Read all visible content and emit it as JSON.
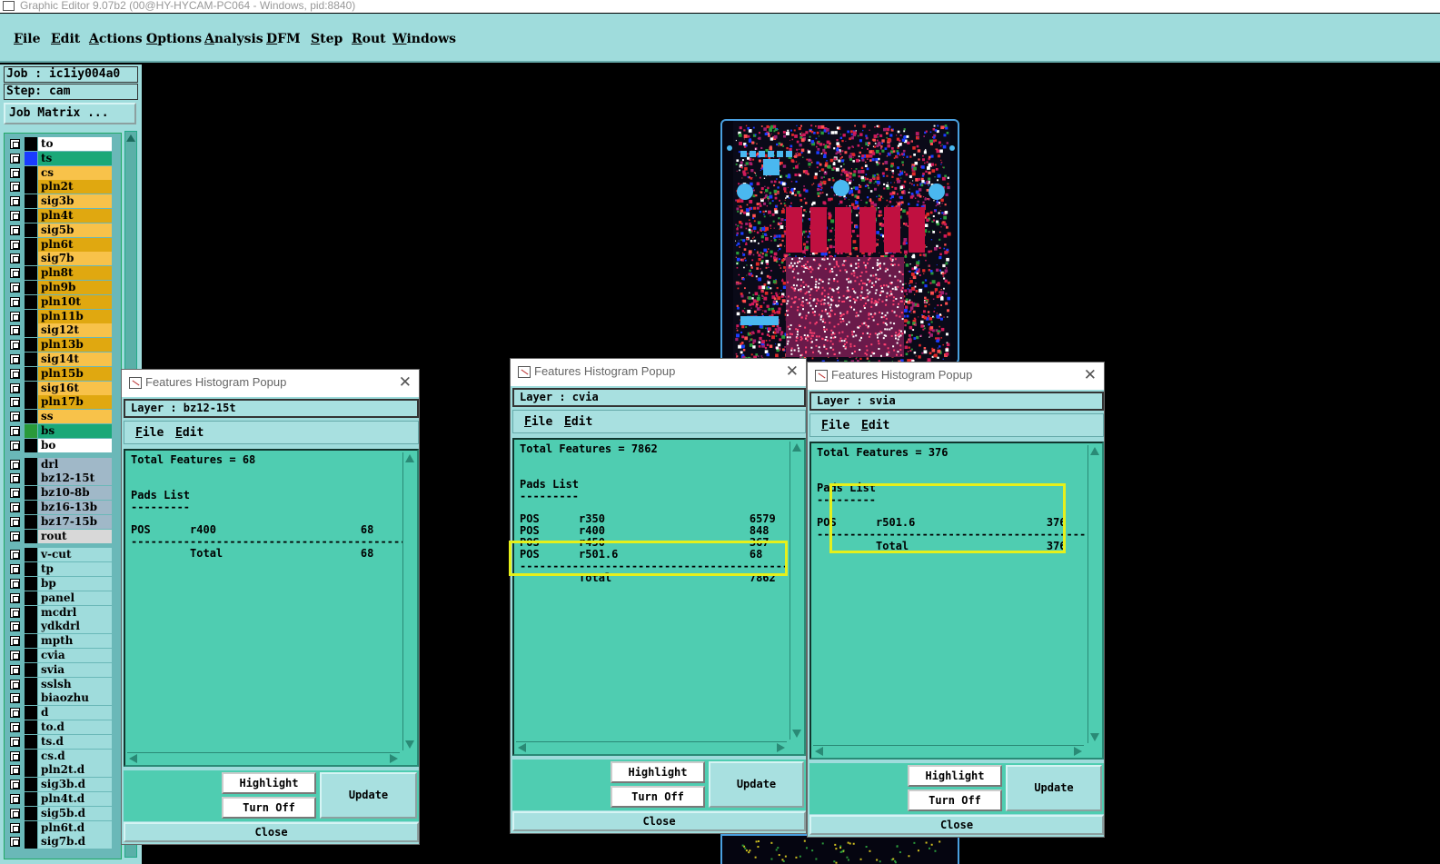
{
  "window": {
    "title": "Graphic Editor 9.07b2 (00@HY-HYCAM-PC064 - Windows, pid:8840)"
  },
  "menu": [
    "File",
    "Edit",
    "Actions",
    "Options",
    "Analysis",
    "DFM",
    "Step",
    "Rout",
    "Windows"
  ],
  "job": {
    "job_label": "Job : ic1iy004a0",
    "step_label": "Step: cam",
    "matrix_button": "Job Matrix ..."
  },
  "layers": [
    {
      "name": "to",
      "color": "#ffffff",
      "swatch": "#000000",
      "edit": "&#9998;"
    },
    {
      "name": "ts",
      "color": "#1aa878",
      "swatch": "#1a3cff"
    },
    {
      "name": "cs",
      "color": "#f8c24a",
      "swatch": "#000000"
    },
    {
      "name": "pln2t",
      "color": "#e0a810",
      "swatch": "#000000"
    },
    {
      "name": "sig3b",
      "color": "#f8c24a",
      "swatch": "#000000"
    },
    {
      "name": "pln4t",
      "color": "#e0a810",
      "swatch": "#000000"
    },
    {
      "name": "sig5b",
      "color": "#f8c24a",
      "swatch": "#000000"
    },
    {
      "name": "pln6t",
      "color": "#e0a810",
      "swatch": "#000000"
    },
    {
      "name": "sig7b",
      "color": "#f8c24a",
      "swatch": "#000000"
    },
    {
      "name": "pln8t",
      "color": "#e0a810",
      "swatch": "#000000"
    },
    {
      "name": "pln9b",
      "color": "#e0a810",
      "swatch": "#000000"
    },
    {
      "name": "pln10t",
      "color": "#e0a810",
      "swatch": "#000000"
    },
    {
      "name": "pln11b",
      "color": "#e0a810",
      "swatch": "#000000"
    },
    {
      "name": "sig12t",
      "color": "#f8c24a",
      "swatch": "#000000"
    },
    {
      "name": "pln13b",
      "color": "#e0a810",
      "swatch": "#000000"
    },
    {
      "name": "sig14t",
      "color": "#f8c24a",
      "swatch": "#000000"
    },
    {
      "name": "pln15b",
      "color": "#e0a810",
      "swatch": "#000000"
    },
    {
      "name": "sig16t",
      "color": "#f8c24a",
      "swatch": "#000000"
    },
    {
      "name": "pln17b",
      "color": "#e0a810",
      "swatch": "#000000"
    },
    {
      "name": "ss",
      "color": "#f8c24a",
      "swatch": "#000000"
    },
    {
      "name": "bs",
      "color": "#1aa878",
      "swatch": "#2a9a3a"
    },
    {
      "name": "bo",
      "color": "#ffffff",
      "swatch": "#000000"
    },
    {
      "gap": true
    },
    {
      "name": "drl",
      "color": "#a0b8c8",
      "swatch": "#000000"
    },
    {
      "name": "bz12-15t",
      "color": "#a0b8c8",
      "swatch": "#000000"
    },
    {
      "name": "bz10-8b",
      "color": "#a0b8c8",
      "swatch": "#000000"
    },
    {
      "name": "bz16-13b",
      "color": "#a0b8c8",
      "swatch": "#000000"
    },
    {
      "name": "bz17-15b",
      "color": "#a0b8c8",
      "swatch": "#000000"
    },
    {
      "name": "rout",
      "color": "#d8d8d8",
      "swatch": "#000000"
    },
    {
      "gap": true
    },
    {
      "name": "v-cut",
      "color": "#9fdcdc",
      "swatch": "#000000"
    },
    {
      "name": "tp",
      "color": "#9fdcdc",
      "swatch": "#000000"
    },
    {
      "name": "bp",
      "color": "#9fdcdc",
      "swatch": "#000000"
    },
    {
      "name": "panel",
      "color": "#9fdcdc",
      "swatch": "#000000"
    },
    {
      "name": "mcdrl",
      "color": "#9fdcdc",
      "swatch": "#000000"
    },
    {
      "name": "ydkdrl",
      "color": "#9fdcdc",
      "swatch": "#000000"
    },
    {
      "name": "mpth",
      "color": "#9fdcdc",
      "swatch": "#000000"
    },
    {
      "name": "cvia",
      "color": "#9fdcdc",
      "swatch": "#000000"
    },
    {
      "name": "svia",
      "color": "#9fdcdc",
      "swatch": "#000000"
    },
    {
      "name": "sslsh",
      "color": "#9fdcdc",
      "swatch": "#000000"
    },
    {
      "name": "biaozhu",
      "color": "#9fdcdc",
      "swatch": "#000000"
    },
    {
      "name": "d",
      "color": "#9fdcdc",
      "swatch": "#000000"
    },
    {
      "name": "to.d",
      "color": "#9fdcdc",
      "swatch": "#000000"
    },
    {
      "name": "ts.d",
      "color": "#9fdcdc",
      "swatch": "#000000"
    },
    {
      "name": "cs.d",
      "color": "#9fdcdc",
      "swatch": "#000000"
    },
    {
      "name": "pln2t.d",
      "color": "#9fdcdc",
      "swatch": "#000000"
    },
    {
      "name": "sig3b.d",
      "color": "#9fdcdc",
      "swatch": "#000000"
    },
    {
      "name": "pln4t.d",
      "color": "#9fdcdc",
      "swatch": "#000000"
    },
    {
      "name": "sig5b.d",
      "color": "#9fdcdc",
      "swatch": "#000000"
    },
    {
      "name": "pln6t.d",
      "color": "#9fdcdc",
      "swatch": "#000000"
    },
    {
      "name": "sig7b.d",
      "color": "#9fdcdc",
      "swatch": "#000000"
    }
  ],
  "popups": [
    {
      "title": "Features Histogram Popup",
      "layer": "Layer :  bz12-15t",
      "menu": [
        "File",
        "Edit"
      ],
      "text": "Total Features = 68\n\n\nPads List\n---------\n\nPOS      r400                      68\n------------------------------------------\n         Total                     68",
      "buttons": {
        "highlight": "Highlight",
        "turn_off": "Turn Off",
        "update": "Update",
        "close": "Close"
      }
    },
    {
      "title": "Features Histogram Popup",
      "layer": "Layer :  cvia",
      "menu": [
        "File",
        "Edit"
      ],
      "text": "Total Features = 7862\n\n\nPads List\n---------\n\nPOS      r350                      6579\nPOS      r400                      848\nPOS      r450                      367\nPOS      r501.6                    68\n------------------------------------------\n         Total                     7862",
      "buttons": {
        "highlight": "Highlight",
        "turn_off": "Turn Off",
        "update": "Update",
        "close": "Close"
      }
    },
    {
      "title": "Features Histogram Popup",
      "layer": "Layer :  svia",
      "menu": [
        "File",
        "Edit"
      ],
      "text": "Total Features = 376\n\n\nPads List\n---------\n\nPOS      r501.6                    376\n------------------------------------------\n         Total                     376",
      "buttons": {
        "highlight": "Highlight",
        "turn_off": "Turn Off",
        "update": "Update",
        "close": "Close"
      }
    }
  ]
}
